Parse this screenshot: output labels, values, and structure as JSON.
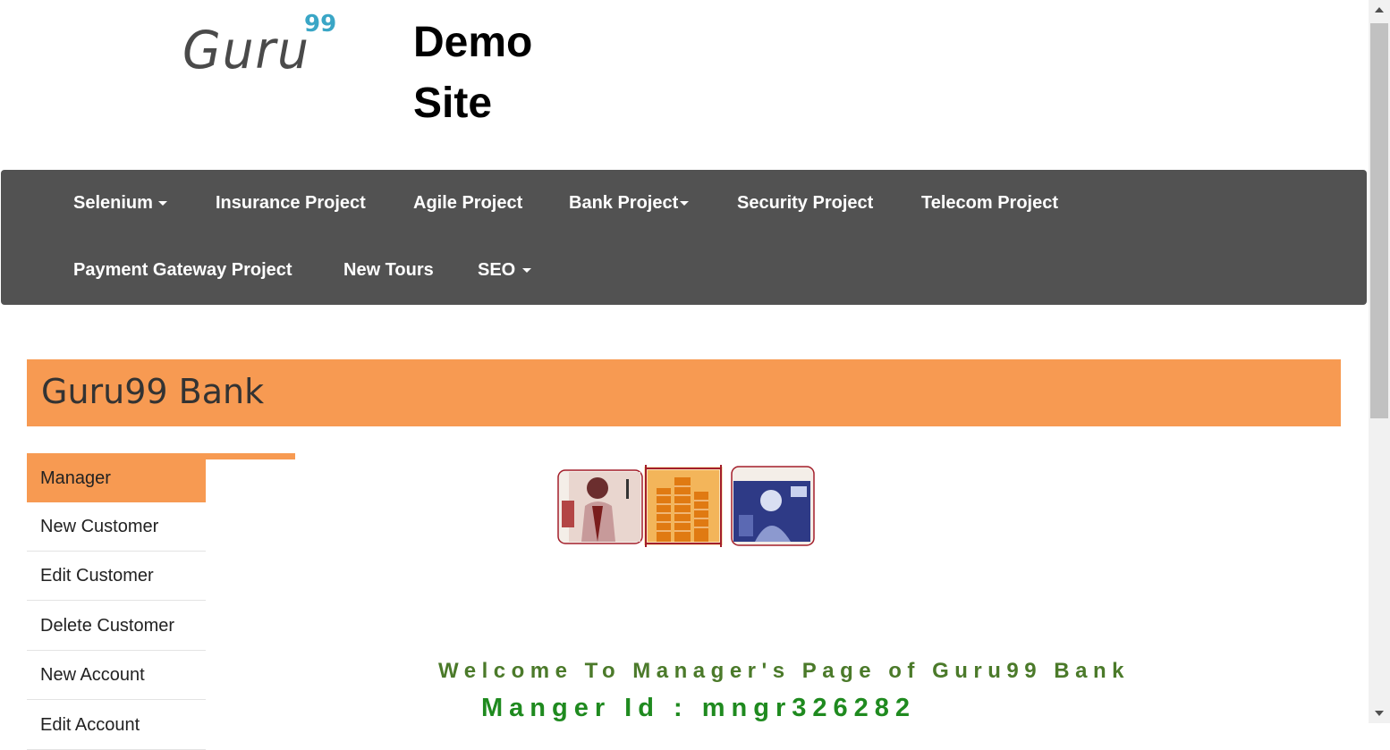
{
  "header": {
    "logo_text": "Guru",
    "logo_sup": "99",
    "site_title": "Demo Site"
  },
  "navbar": {
    "items": [
      {
        "label": "Selenium",
        "dropdown": true
      },
      {
        "label": "Insurance Project",
        "dropdown": false
      },
      {
        "label": "Agile Project",
        "dropdown": false
      },
      {
        "label": "Bank Project",
        "dropdown": true
      },
      {
        "label": "Security Project",
        "dropdown": false
      },
      {
        "label": "Telecom Project",
        "dropdown": false
      },
      {
        "label": "Payment Gateway Project",
        "dropdown": false
      },
      {
        "label": "New Tours",
        "dropdown": false
      },
      {
        "label": "SEO",
        "dropdown": true
      }
    ]
  },
  "bank": {
    "title": "Guru99 Bank"
  },
  "sidebar": {
    "items": [
      {
        "label": "Manager",
        "active": true
      },
      {
        "label": "New Customer"
      },
      {
        "label": "Edit Customer"
      },
      {
        "label": "Delete Customer"
      },
      {
        "label": "New Account"
      },
      {
        "label": "Edit Account"
      }
    ]
  },
  "main": {
    "welcome": "Welcome To Manager's Page of Guru99 Bank",
    "manager_id": "Manger Id : mngr326282"
  },
  "colors": {
    "navbar_bg": "#525252",
    "accent_orange": "#f79a52",
    "welcome_green": "#4b7a2a",
    "manager_green": "#1f8a1f"
  }
}
